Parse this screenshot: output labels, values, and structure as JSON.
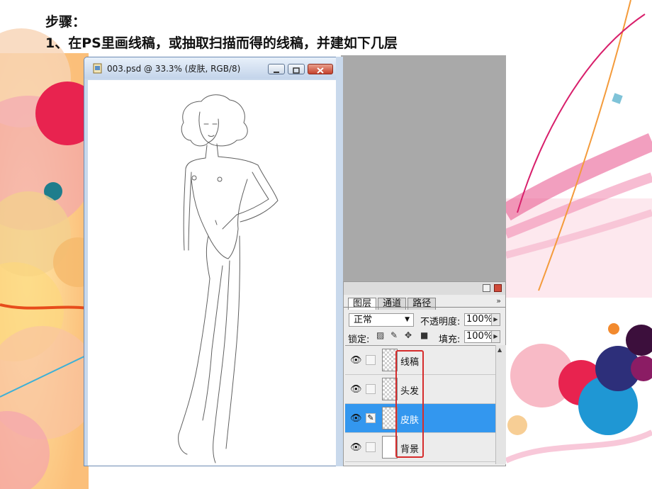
{
  "slide": {
    "heading1": "步骤：",
    "heading2": "1、在PS里画线稿，或抽取扫描而得的线稿，并建如下几层"
  },
  "document_window": {
    "title": "003.psd @ 33.3% (皮肤, RGB/8)",
    "icon": "psd-document-icon"
  },
  "layers_panel": {
    "tabs": [
      {
        "label": "图层",
        "active": true
      },
      {
        "label": "通道",
        "active": false
      },
      {
        "label": "路径",
        "active": false
      }
    ],
    "more": "»",
    "blend_mode": "正常",
    "opacity_label": "不透明度:",
    "opacity_value": "100%",
    "lock_label": "锁定:",
    "fill_label": "填充:",
    "fill_value": "100%",
    "layers": [
      {
        "name": "线稿",
        "selected": false,
        "thumb": "transparent"
      },
      {
        "name": "头发",
        "selected": false,
        "thumb": "transparent"
      },
      {
        "name": "皮肤",
        "selected": true,
        "thumb": "transparent"
      },
      {
        "name": "背景",
        "selected": false,
        "thumb": "white"
      }
    ]
  },
  "colors": {
    "selected_layer": "#3397ef",
    "highlight_box": "#d62c2c",
    "workspace": "#a9a9a9"
  }
}
